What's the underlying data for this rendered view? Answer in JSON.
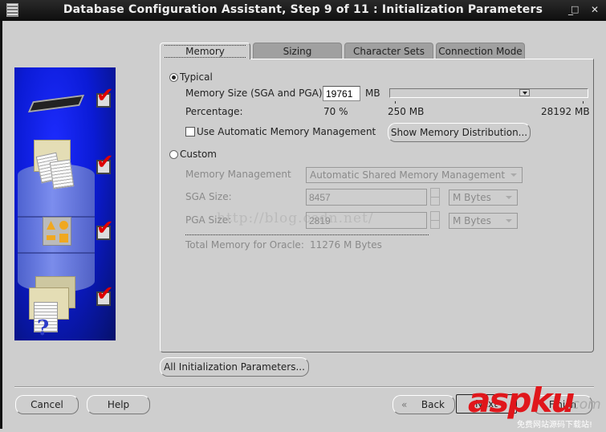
{
  "window": {
    "title": "Database Configuration Assistant, Step 9 of 11 : Initialization Parameters",
    "controls": {
      "minimize": "_",
      "maximize": "□",
      "close": "✕"
    }
  },
  "tabs": [
    {
      "label": "Memory",
      "active": true
    },
    {
      "label": "Sizing",
      "active": false
    },
    {
      "label": "Character Sets",
      "active": false
    },
    {
      "label": "Connection Mode",
      "active": false
    }
  ],
  "memory": {
    "typical": {
      "label": "Typical",
      "selected": true,
      "memory_size_label": "Memory Size (SGA and PGA):",
      "memory_size_value": "19761",
      "memory_size_unit": "MB",
      "percentage_label": "Percentage:",
      "percentage_value": "70 %",
      "slider_min_label": "250 MB",
      "slider_max_label": "28192 MB",
      "slider_value_mb": 19761,
      "slider_min_mb": 250,
      "slider_max_mb": 28192,
      "amm_checkbox_label": "Use Automatic Memory Management",
      "amm_checked": false,
      "show_distribution_button": "Show Memory Distribution..."
    },
    "custom": {
      "label": "Custom",
      "selected": false,
      "memory_management_label": "Memory Management",
      "memory_management_value": "Automatic Shared Memory Management",
      "sga_label": "SGA Size:",
      "sga_value": "8457",
      "sga_unit": "M Bytes",
      "pga_label": "PGA Size:",
      "pga_value": "2819",
      "pga_unit": "M Bytes",
      "total_label": "Total Memory for Oracle:",
      "total_value": "11276 M Bytes"
    }
  },
  "buttons": {
    "all_init_params": "All Initialization Parameters...",
    "cancel": "Cancel",
    "help": "Help",
    "back": "Back",
    "next": "Next",
    "finish": "Finish"
  },
  "watermarks": {
    "url": "http://blog.csdn.net/",
    "brand": "aspku",
    "brand_suffix": ".com",
    "brand_tagline": "免费网站源码下载站!"
  }
}
